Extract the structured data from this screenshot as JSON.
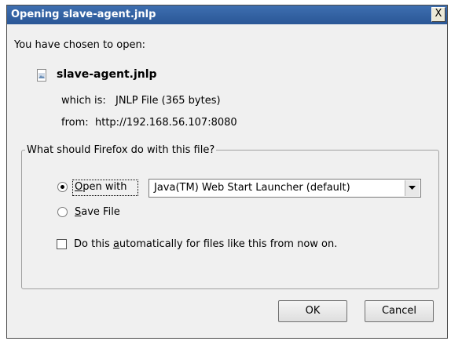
{
  "dialog": {
    "title": "Opening slave-agent.jnlp",
    "close_label": "X"
  },
  "intro": "You have chosen to open:",
  "file": {
    "icon": "jnlp-file-icon",
    "name": "slave-agent.jnlp",
    "which_is_label": "which is:",
    "which_is_value": "JNLP File (365 bytes)",
    "from_label": "from:",
    "from_value": "http://192.168.56.107:8080"
  },
  "action_group": {
    "legend": "What should Firefox do with this file?",
    "open_with": {
      "label_pre": "",
      "label_accel": "O",
      "label_post": "pen with",
      "selected": true
    },
    "open_with_app": "Java(TM) Web Start Launcher (default)",
    "save_file": {
      "label_accel": "S",
      "label_post": "ave File",
      "selected": false
    },
    "auto": {
      "label_pre": "Do this ",
      "label_accel": "a",
      "label_post": "utomatically for files like this from now on.",
      "checked": false
    }
  },
  "buttons": {
    "ok": "OK",
    "cancel": "Cancel"
  }
}
